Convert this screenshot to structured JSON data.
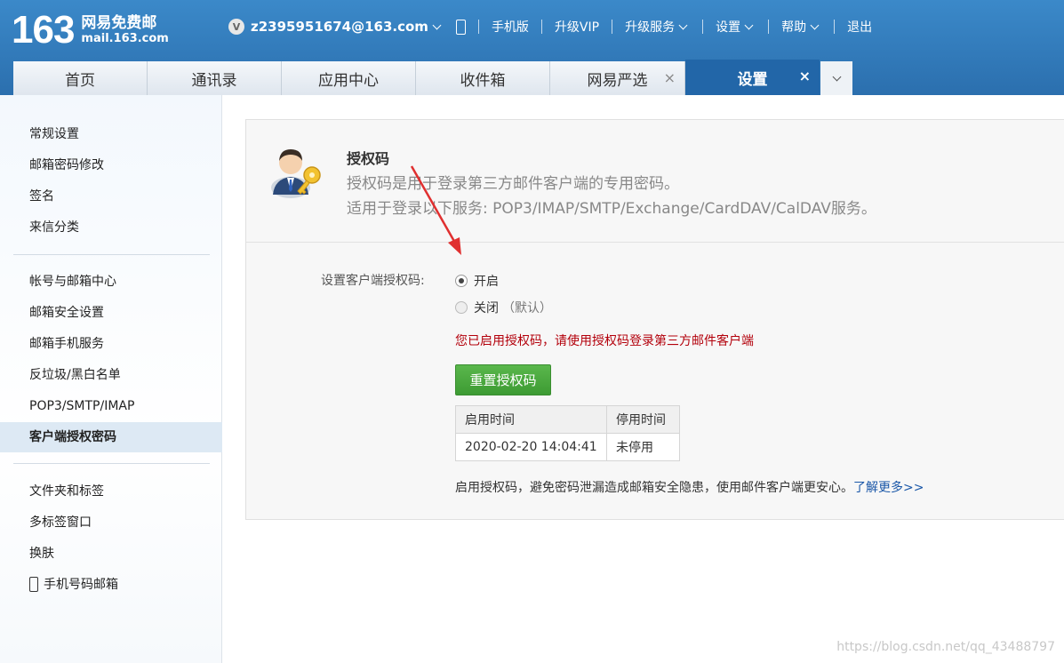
{
  "header": {
    "logo_number": "163",
    "logo_cn": "网易免费邮",
    "logo_en": "mail.163.com",
    "vip_badge": "V",
    "account": "z2395951674@163.com",
    "links": [
      "手机版",
      "升级VIP",
      "升级服务",
      "设置",
      "帮助",
      "退出"
    ]
  },
  "tabs": [
    {
      "label": "首页"
    },
    {
      "label": "通讯录"
    },
    {
      "label": "应用中心"
    },
    {
      "label": "收件箱"
    },
    {
      "label": "网易严选",
      "close": "×"
    },
    {
      "label": "设置",
      "close": "×",
      "active": true
    }
  ],
  "sidebar": {
    "group1": [
      "常规设置",
      "邮箱密码修改",
      "签名",
      "来信分类"
    ],
    "group2": [
      "帐号与邮箱中心",
      "邮箱安全设置",
      "邮箱手机服务",
      "反垃圾/黑白名单",
      "POP3/SMTP/IMAP",
      "客户端授权密码"
    ],
    "group3": [
      "文件夹和标签",
      "多标签窗口",
      "换肤",
      "手机号码邮箱"
    ],
    "active_item": "客户端授权密码"
  },
  "panel": {
    "title": "授权码",
    "desc_line1": "授权码是用于登录第三方邮件客户端的专用密码。",
    "desc_line2": "适用于登录以下服务: POP3/IMAP/SMTP/Exchange/CardDAV/CalDAV服务。",
    "form_label": "设置客户端授权码:",
    "option_on": "开启",
    "option_off": "关闭",
    "option_off_note": "（默认）",
    "selected_option": "开启",
    "notice": "您已启用授权码，请使用授权码登录第三方邮件客户端",
    "reset_button": "重置授权码",
    "table": {
      "headers": [
        "启用时间",
        "停用时间"
      ],
      "row": [
        "2020-02-20 14:04:41",
        "未停用"
      ]
    },
    "footer_tip": "启用授权码，避免密码泄漏造成邮箱安全隐患，使用邮件客户端更安心。",
    "learn_more": "了解更多>>"
  },
  "watermark": "https://blog.csdn.net/qq_43488797",
  "colors": {
    "header_blue": "#2b6fae",
    "active_tab": "#2266a8",
    "notice_red": "#b3000b",
    "button_green": "#4aa83e",
    "link_blue": "#1a57a8",
    "annotation_arrow": "#e03030"
  }
}
